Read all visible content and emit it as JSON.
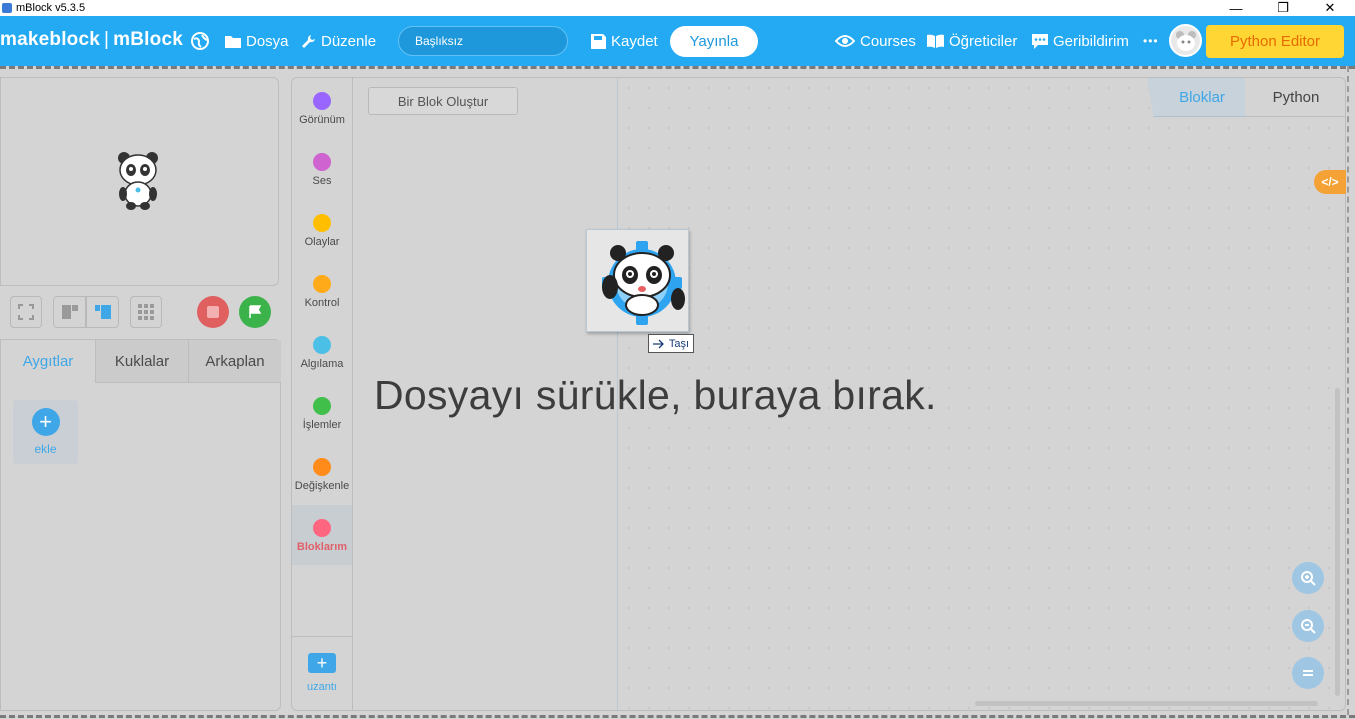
{
  "window": {
    "title": "mBlock v5.3.5",
    "controls": [
      "—",
      "❐",
      "✕"
    ]
  },
  "menubar": {
    "logo": "makeblock",
    "logo_sep": "|",
    "product": "mBlock",
    "items": {
      "file": "Dosya",
      "edit": "Düzenle",
      "save": "Kaydet",
      "publish": "Yayınla",
      "courses": "Courses",
      "tutorials": "Öğreticiler",
      "feedback": "Geribildirim",
      "more": "•••",
      "python_editor": "Python Editor"
    },
    "project_name": "Başlıksız"
  },
  "stage_tabs": [
    "Aygıtlar",
    "Kuklalar",
    "Arkaplan"
  ],
  "devices": {
    "add_label": "ekle"
  },
  "categories": [
    {
      "label": "Görünüm",
      "color": "#9966ff"
    },
    {
      "label": "Ses",
      "color": "#cf63cf"
    },
    {
      "label": "Olaylar",
      "color": "#ffbf00"
    },
    {
      "label": "Kontrol",
      "color": "#ffab19"
    },
    {
      "label": "Algılama",
      "color": "#4cbfe6"
    },
    {
      "label": "İşlemler",
      "color": "#40bf4a"
    },
    {
      "label": "Değişkenle",
      "color": "#ff8c1a"
    },
    {
      "label": "Bloklarım",
      "color": "#ff6680"
    }
  ],
  "extension_label": "uzantı",
  "make_block_label": "Bir Blok Oluştur",
  "mode_tabs": {
    "blocks": "Bloklar",
    "python": "Python"
  },
  "code_toggle": "</>",
  "drop_hint": "Dosyayı sürükle, buraya bırak.",
  "drag_tooltip": "Taşı",
  "colors": {
    "brand_blue": "#23aaf2",
    "python_btn_bg": "#ffd633",
    "python_btn_text": "#e66a00",
    "stop_red": "#e06060",
    "go_green": "#3bb24a"
  }
}
